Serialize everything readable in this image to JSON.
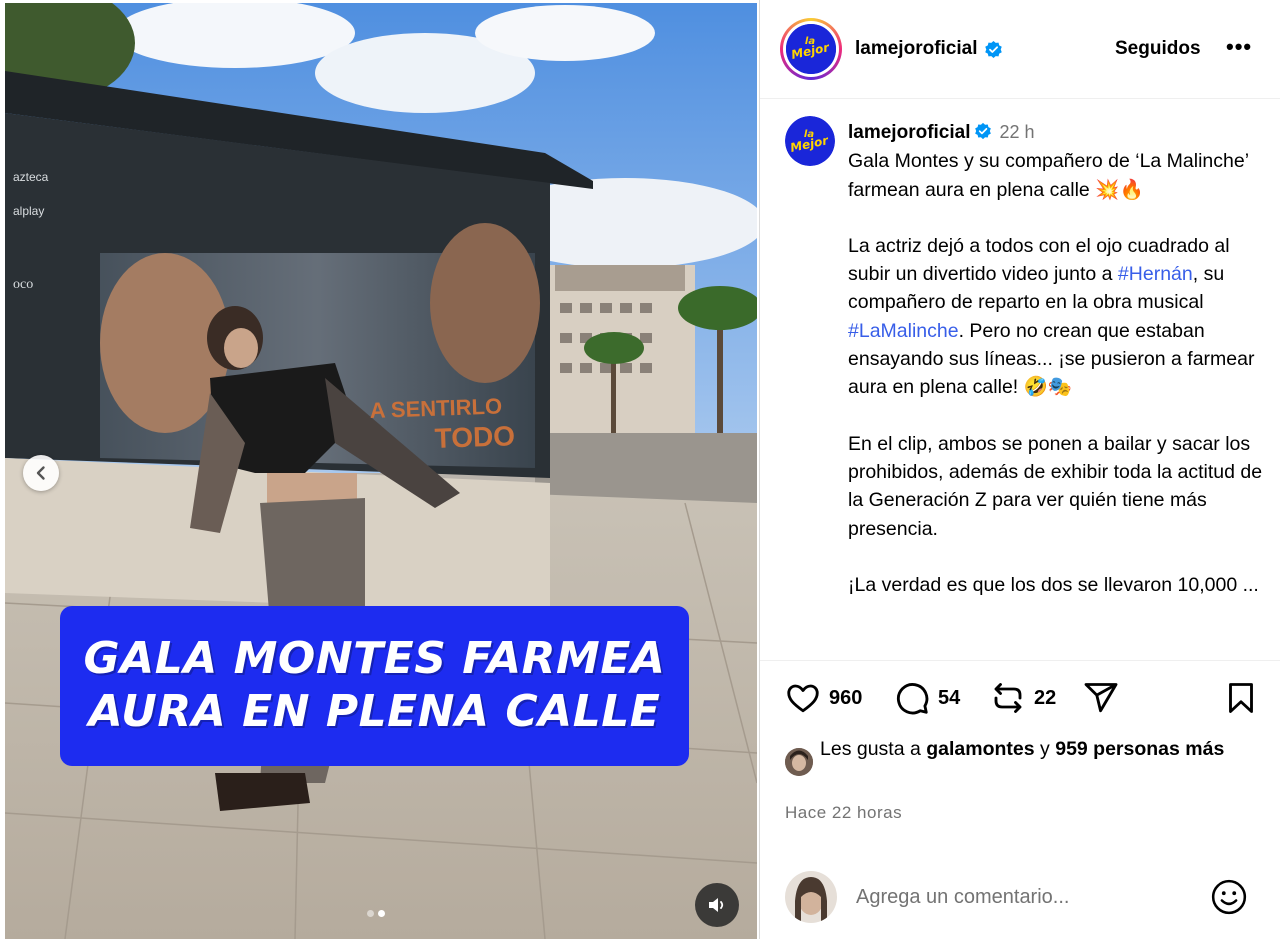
{
  "media": {
    "caption": "GALA MONTES FARMEA\nAURA EN PLENA CALLE",
    "poster_text_line1": "A SENTIRLO",
    "poster_text_line2": "TODO",
    "sign_text_1": "azteca",
    "sign_text_2": "alplay",
    "sign_text_3": "oco",
    "active_slide": 2,
    "slide_count": 2
  },
  "header": {
    "username": "lamejoroficial",
    "follow_label": "Seguidos",
    "more_label": "•••",
    "logo_text_1": "la",
    "logo_text_2": "Mejor"
  },
  "caption": {
    "username": "lamejoroficial",
    "time": "22 h",
    "lead": "Gala Montes y su compañero de ‘La Malinche’ farmean aura en plena calle 💥🔥",
    "p1_a": "La actriz dejó a todos con el ojo cuadrado al subir un divertido video junto a ",
    "p1_tag1": "#Hernán",
    "p1_b": ", su compañero de reparto en la obra musical ",
    "p1_tag2": "#LaMalinche",
    "p1_c": ". Pero no crean que estaban ensayando sus líneas... ¡se pusieron a farmear aura en plena calle! 🤣🎭",
    "p2": "En el clip, ambos se ponen a bailar y sacar los prohibidos, además de exhibir toda la actitud de la Generación Z para ver quién tiene más presencia.",
    "p3": "¡La verdad es que los dos se llevaron 10,000 ..."
  },
  "actions": {
    "likes_count": "960",
    "comments_count": "54",
    "reposts_count": "22"
  },
  "likes": {
    "prefix": "Les gusta a ",
    "user": "galamontes",
    "mid": " y ",
    "others": "959 personas más"
  },
  "posted_ago": "Hace 22 horas",
  "comment": {
    "placeholder": "Agrega un comentario..."
  },
  "colors": {
    "caption_bg": "#1d2cf0",
    "hashtag": "#385ee8",
    "verified": "#0095f6",
    "logo_bg": "#1a26d9",
    "logo_text": "#ffd400"
  }
}
